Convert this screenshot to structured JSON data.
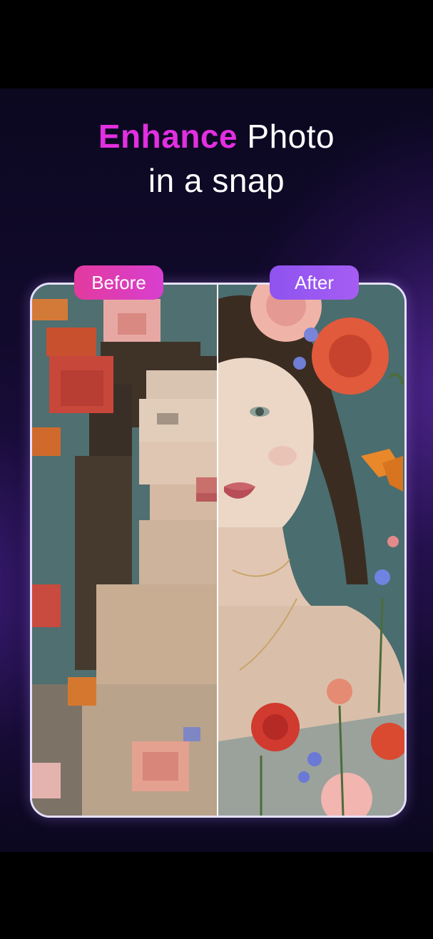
{
  "headline": {
    "accent_word": "Enhance",
    "line1_rest": " Photo",
    "line2": "in a snap"
  },
  "compare": {
    "before_label": "Before",
    "after_label": "After"
  },
  "colors": {
    "accent_pink": "#e22fe0",
    "before_pill": "#e23a9e",
    "after_pill": "#9a58f1",
    "frame_border": "#e6e0ff"
  }
}
